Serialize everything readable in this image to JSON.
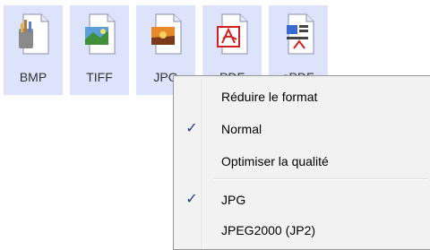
{
  "formats": [
    {
      "label": "BMP",
      "icon": "bmp-file-icon"
    },
    {
      "label": "TIFF",
      "icon": "tiff-file-icon"
    },
    {
      "label": "JPG",
      "icon": "jpg-file-icon"
    },
    {
      "label": "PDF",
      "icon": "pdf-file-icon"
    },
    {
      "label": "sPDF",
      "icon": "spdf-file-icon"
    }
  ],
  "context_menu": {
    "items": [
      {
        "label": "Réduire le format",
        "checked": false
      },
      {
        "label": "Normal",
        "checked": true
      },
      {
        "label": "Optimiser la qualité",
        "checked": false
      },
      {
        "label": "JPG",
        "checked": true
      },
      {
        "label": "JPEG2000 (JP2)",
        "checked": false
      }
    ],
    "check_glyph": "✓"
  },
  "colors": {
    "format_bg": "#dde3fa",
    "menu_bg": "#f2f2f2",
    "check": "#1e3e86"
  }
}
